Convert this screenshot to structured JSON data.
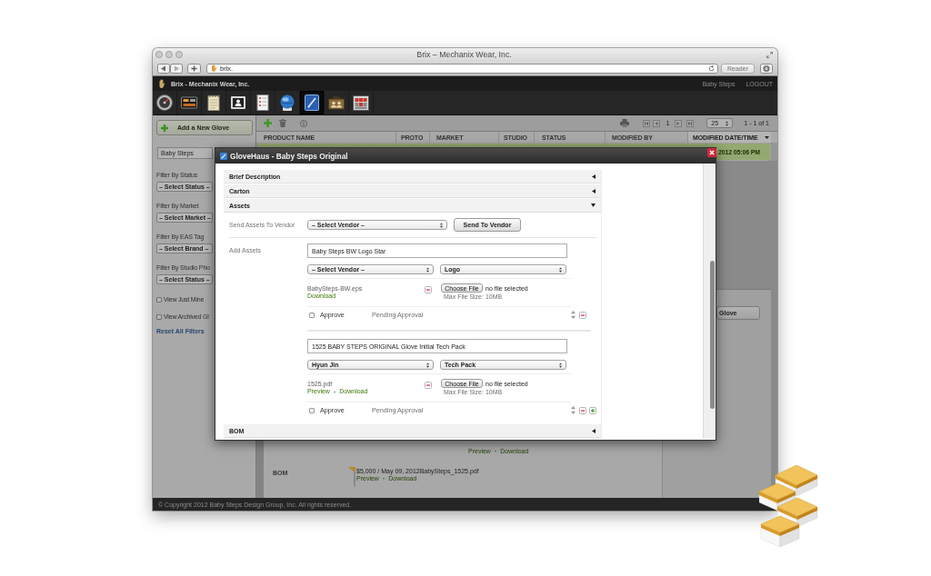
{
  "browser": {
    "title": "Brix – Mechanix Wear, Inc.",
    "url": "brix.",
    "reader_button": "Reader"
  },
  "app_header": {
    "brand": "Brix - Mechanix Wear, Inc.",
    "user": "Baby Steps",
    "logout": "LOGOUT"
  },
  "nav_icons": [
    {
      "kind": "gauge",
      "selected": false
    },
    {
      "kind": "board",
      "selected": false
    },
    {
      "kind": "notepad",
      "selected": false
    },
    {
      "kind": "contact",
      "selected": false
    },
    {
      "kind": "checklist",
      "selected": false
    },
    {
      "kind": "globe",
      "selected": false
    },
    {
      "kind": "notebook",
      "selected": true
    },
    {
      "kind": "briefcase",
      "selected": false
    },
    {
      "kind": "calendar",
      "selected": false
    }
  ],
  "sidebar": {
    "add_button": "Add a New Glove",
    "search_value": "Baby Steps",
    "filters": [
      {
        "label": "Filter By Status",
        "value": "– Select Status –"
      },
      {
        "label": "Filter By Market",
        "value": "– Select Market –"
      },
      {
        "label": "Filter By EAS Tag",
        "value": "– Select Brand –"
      },
      {
        "label": "Filter By Studio Pho",
        "value": "– Select Status –"
      }
    ],
    "checkboxes": [
      {
        "label": "View Just Mine",
        "checked": false
      },
      {
        "label": "View Archived Gl",
        "checked": false
      }
    ],
    "reset_link": "Reset All Filters"
  },
  "toolbar": {
    "page": "1",
    "page_size": "25",
    "range": "1 - 1 of 1"
  },
  "table": {
    "columns": [
      {
        "label": "PRODUCT NAME",
        "sorted": false
      },
      {
        "label": "PROTO",
        "sorted": false
      },
      {
        "label": "MARKET",
        "sorted": false
      },
      {
        "label": "STUDIO",
        "sorted": false
      },
      {
        "label": "STATUS",
        "sorted": false
      },
      {
        "label": "MODIFIED BY",
        "sorted": false
      },
      {
        "label": "MODIFIED DATE/TIME",
        "sorted": true
      }
    ],
    "rows": [
      {
        "modified_date_time": "2012 05:06 PM",
        "selected": true
      }
    ]
  },
  "detail": {
    "links": [
      {
        "label": "Preview"
      },
      {
        "label": "Download"
      }
    ],
    "link_separator": "·",
    "bom": {
      "label": "BOM",
      "value": "$5,000 / May 09, 2012BabySteps_1525.pdf",
      "links": [
        {
          "label": "Preview"
        },
        {
          "label": "Download"
        }
      ],
      "link_separator": "·"
    }
  },
  "side_panel": {
    "button": "Glove"
  },
  "footer": {
    "copyright": "© Copyright 2012 Baby Steps Design Group, Inc. All rights reserved."
  },
  "modal": {
    "title": "GloveHaus - Baby Steps Original",
    "sections": [
      {
        "title": "Brief Description",
        "expanded": false
      },
      {
        "title": "Carton",
        "expanded": false
      },
      {
        "title": "Assets",
        "expanded": true,
        "assets": {
          "send_label": "Send Assets To Vendor",
          "send_vendor": "– Select Vendor –",
          "send_button": "Send To Vendor",
          "add_label": "Add Assets",
          "items": [
            {
              "name": "Baby Steps BW Logo Star",
              "vendor": "– Select Vendor –",
              "type": "Logo",
              "file": "BabySteps-BW.eps",
              "links": [
                {
                  "label": "Download"
                }
              ],
              "choose_button": "Choose File",
              "file_status": "no file selected",
              "max_size": "Max File Size: 10MB",
              "approve_label": "Approve",
              "approved": false,
              "status": "Pending Approval"
            },
            {
              "name": "1525 BABY STEPS ORIGINAL Glove Initial Tech Pack",
              "vendor": "Hyun Jin",
              "type": "Tech Pack",
              "file": "1525.pdf",
              "links": [
                {
                  "label": "Preview"
                },
                {
                  "label": "Download"
                }
              ],
              "link_separator": "-",
              "choose_button": "Choose File",
              "file_status": "no file selected",
              "max_size": "Max File Size: 10MB",
              "approve_label": "Approve",
              "approved": false,
              "status": "Pending Approval"
            }
          ]
        }
      },
      {
        "title": "BOM",
        "expanded": false
      }
    ]
  }
}
